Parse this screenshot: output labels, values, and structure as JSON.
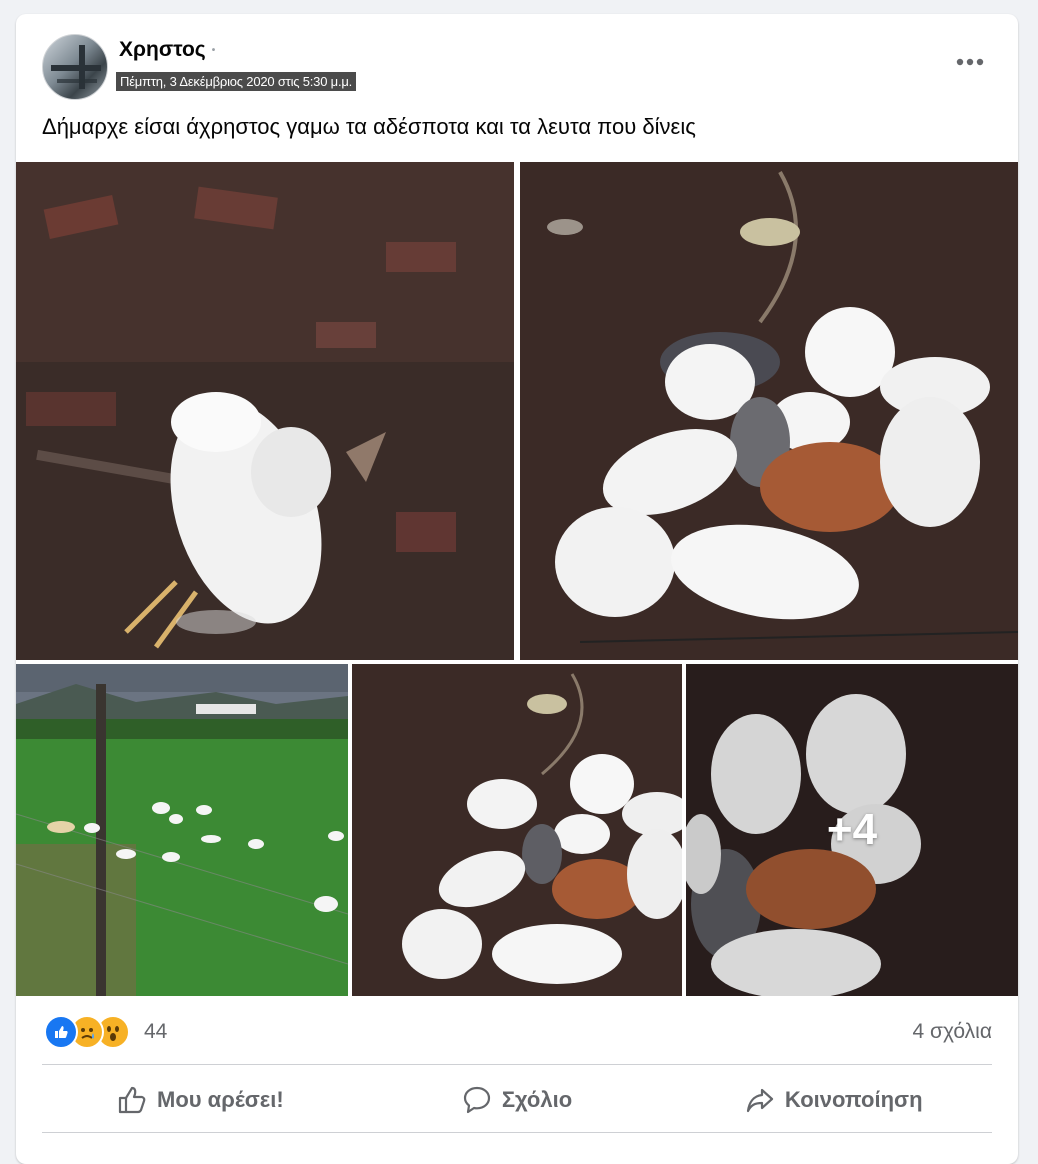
{
  "post": {
    "author": "Χρηστος",
    "timestamp": "Πέμπτη, 3 Δεκέμβριος 2020 στις 5:30 μ.μ.",
    "text": "Δήμαρχε είσαι άχρηστος γαμω τα αδέσποτα και τα λευτα που δίνεις",
    "more_photos_label": "+4"
  },
  "icons": {
    "more": "more-horizontal-icon",
    "like": "thumbs-up-icon",
    "comment": "speech-bubble-icon",
    "share": "share-arrow-icon"
  },
  "reactions": {
    "types": [
      "like",
      "sad",
      "wow"
    ],
    "count": "44",
    "comments": "4 σχόλια"
  },
  "actions": {
    "like": "Μου αρέσει!",
    "comment": "Σχόλιο",
    "share": "Κοινοποίηση"
  },
  "colors": {
    "like_blue": "#1877f2",
    "emoji_yellow": "#f7b125",
    "text_secondary": "#65676b"
  }
}
